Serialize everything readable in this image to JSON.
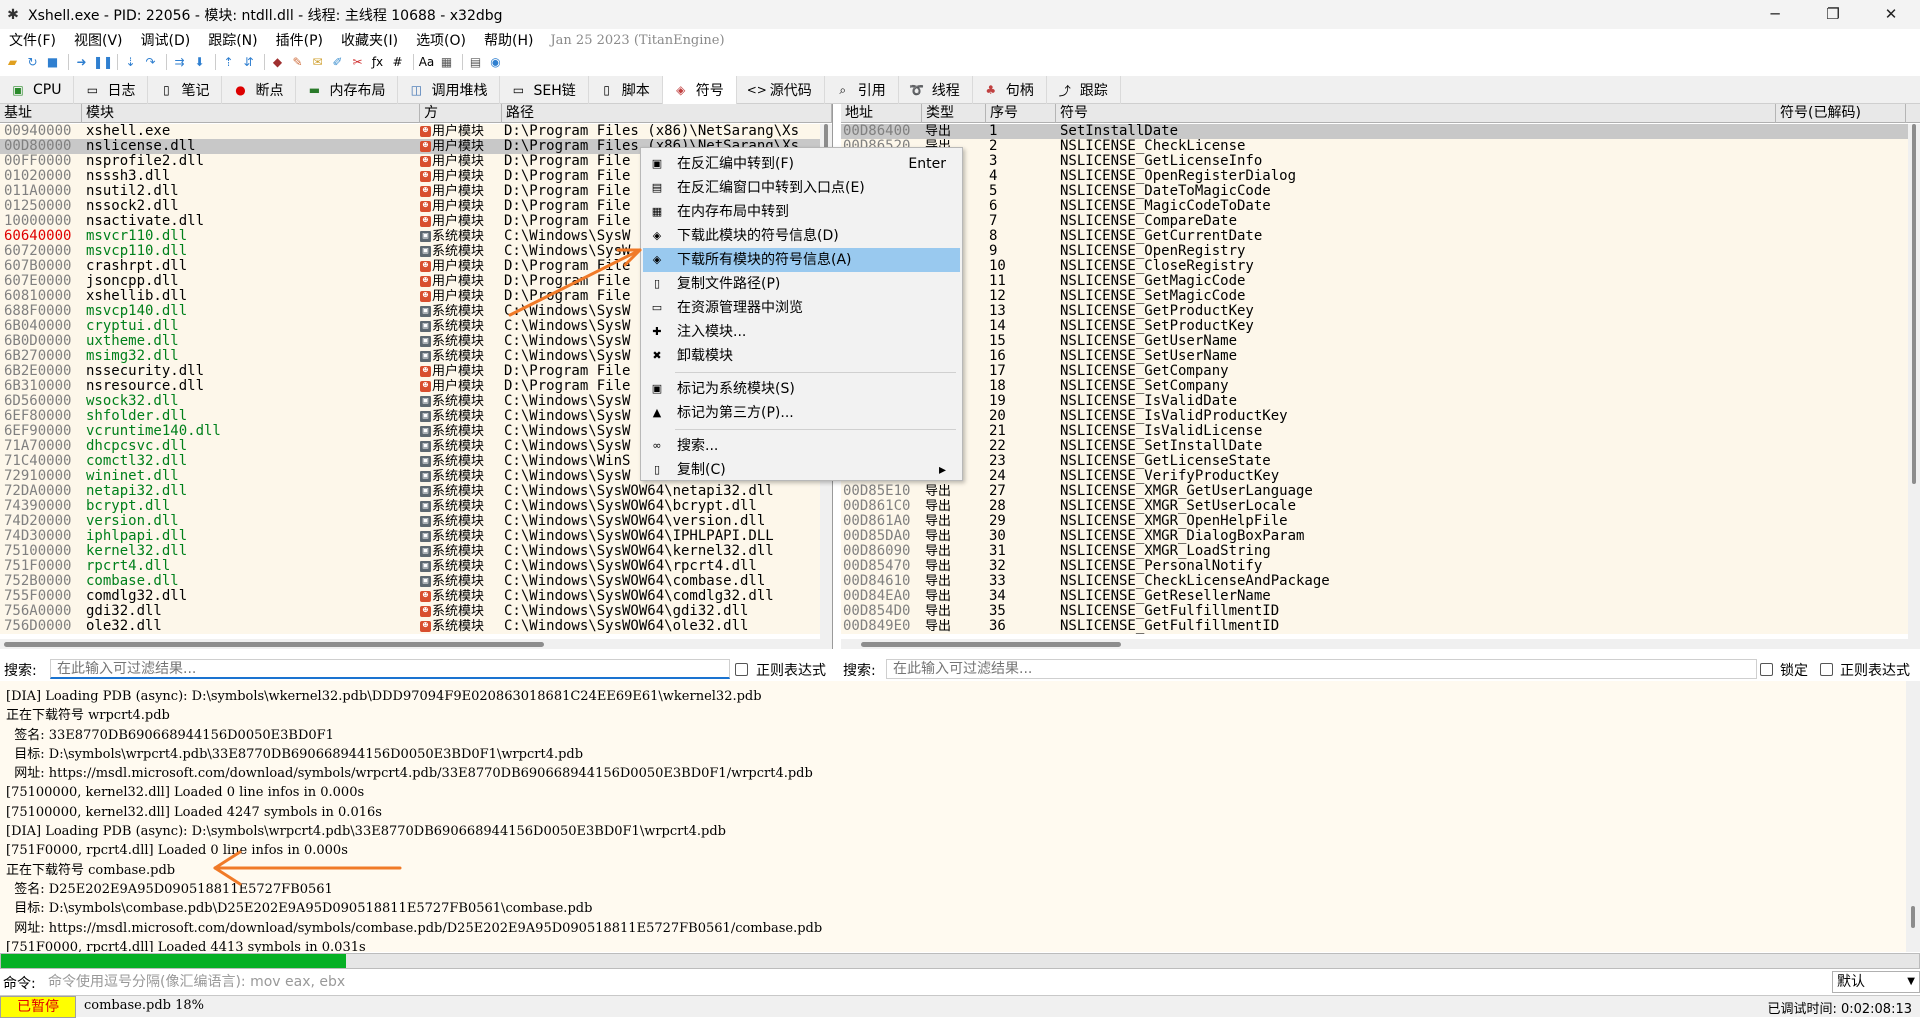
{
  "title": "Xshell.exe - PID: 22056 - 模块: ntdll.dll - 线程: 主线程 10688 - x32dbg",
  "menu": [
    "文件(F)",
    "视图(V)",
    "调试(D)",
    "跟踪(N)",
    "插件(P)",
    "收藏夹(I)",
    "选项(O)",
    "帮助(H)"
  ],
  "build_date": "Jan 25 2023 (TitanEngine)",
  "tabs": [
    "CPU",
    "日志",
    "笔记",
    "断点",
    "内存布局",
    "调用堆栈",
    "SEH链",
    "脚本",
    "符号",
    "源代码",
    "引用",
    "线程",
    "句柄",
    "跟踪"
  ],
  "active_tab": "符号",
  "modules": {
    "headers": [
      "基址",
      "模块",
      "方",
      "路径"
    ],
    "rows": [
      {
        "base": "00940000",
        "name": "xshell.exe",
        "type": "用户模块",
        "path": "D:\\Program Files (x86)\\NetSarang\\Xs",
        "kind": "user"
      },
      {
        "base": "00D80000",
        "name": "nslicense.dll",
        "type": "用户模块",
        "path": "D:\\Program Files (x86)\\NetSarang\\Xs",
        "kind": "user",
        "selected": true
      },
      {
        "base": "00FF0000",
        "name": "nsprofile2.dll",
        "type": "用户模块",
        "path": "D:\\Program File",
        "kind": "user"
      },
      {
        "base": "01020000",
        "name": "nsssh3.dll",
        "type": "用户模块",
        "path": "D:\\Program File",
        "kind": "user"
      },
      {
        "base": "011A0000",
        "name": "nsutil2.dll",
        "type": "用户模块",
        "path": "D:\\Program File",
        "kind": "user"
      },
      {
        "base": "01250000",
        "name": "nssock2.dll",
        "type": "用户模块",
        "path": "D:\\Program File",
        "kind": "user"
      },
      {
        "base": "10000000",
        "name": "nsactivate.dll",
        "type": "用户模块",
        "path": "D:\\Program File",
        "kind": "user"
      },
      {
        "base": "60640000",
        "name": "msvcr110.dll",
        "type": "系统模块",
        "path": "C:\\Windows\\SysW",
        "kind": "sys",
        "basered": true
      },
      {
        "base": "60720000",
        "name": "msvcp110.dll",
        "type": "系统模块",
        "path": "C:\\Windows\\SysW",
        "kind": "sys"
      },
      {
        "base": "607B0000",
        "name": "crashrpt.dll",
        "type": "用户模块",
        "path": "D:\\Program File",
        "kind": "user"
      },
      {
        "base": "607E0000",
        "name": "jsoncpp.dll",
        "type": "用户模块",
        "path": "D:\\Program File",
        "kind": "user"
      },
      {
        "base": "60810000",
        "name": "xshellib.dll",
        "type": "用户模块",
        "path": "D:\\Program File",
        "kind": "user"
      },
      {
        "base": "688F0000",
        "name": "msvcp140.dll",
        "type": "系统模块",
        "path": "C:\\Windows\\SysW",
        "kind": "sys"
      },
      {
        "base": "6B040000",
        "name": "cryptui.dll",
        "type": "系统模块",
        "path": "C:\\Windows\\SysW",
        "kind": "sys"
      },
      {
        "base": "6B0D0000",
        "name": "uxtheme.dll",
        "type": "系统模块",
        "path": "C:\\Windows\\SysW",
        "kind": "sys"
      },
      {
        "base": "6B270000",
        "name": "msimg32.dll",
        "type": "系统模块",
        "path": "C:\\Windows\\SysW",
        "kind": "sys"
      },
      {
        "base": "6B2E0000",
        "name": "nssecurity.dll",
        "type": "用户模块",
        "path": "D:\\Program File",
        "kind": "user"
      },
      {
        "base": "6B310000",
        "name": "nsresource.dll",
        "type": "用户模块",
        "path": "D:\\Program File",
        "kind": "user"
      },
      {
        "base": "6D560000",
        "name": "wsock32.dll",
        "type": "系统模块",
        "path": "C:\\Windows\\SysW",
        "kind": "sys"
      },
      {
        "base": "6EF80000",
        "name": "shfolder.dll",
        "type": "系统模块",
        "path": "C:\\Windows\\SysW",
        "kind": "sys"
      },
      {
        "base": "6EF90000",
        "name": "vcruntime140.dll",
        "type": "系统模块",
        "path": "C:\\Windows\\SysW",
        "kind": "sys"
      },
      {
        "base": "71A70000",
        "name": "dhcpcsvc.dll",
        "type": "系统模块",
        "path": "C:\\Windows\\SysW",
        "kind": "sys"
      },
      {
        "base": "71C40000",
        "name": "comctl32.dll",
        "type": "系统模块",
        "path": "C:\\Windows\\WinS",
        "kind": "sys"
      },
      {
        "base": "72910000",
        "name": "wininet.dll",
        "type": "系统模块",
        "path": "C:\\Windows\\SysW",
        "kind": "sys"
      },
      {
        "base": "72DA0000",
        "name": "netapi32.dll",
        "type": "系统模块",
        "path": "C:\\Windows\\SysWOW64\\netapi32.dll",
        "kind": "sys"
      },
      {
        "base": "74390000",
        "name": "bcrypt.dll",
        "type": "系统模块",
        "path": "C:\\Windows\\SysWOW64\\bcrypt.dll",
        "kind": "sys"
      },
      {
        "base": "74D20000",
        "name": "version.dll",
        "type": "系统模块",
        "path": "C:\\Windows\\SysWOW64\\version.dll",
        "kind": "sys"
      },
      {
        "base": "74D30000",
        "name": "iphlpapi.dll",
        "type": "系统模块",
        "path": "C:\\Windows\\SysWOW64\\IPHLPAPI.DLL",
        "kind": "sys"
      },
      {
        "base": "75100000",
        "name": "kernel32.dll",
        "type": "系统模块",
        "path": "C:\\Windows\\SysWOW64\\kernel32.dll",
        "kind": "sys"
      },
      {
        "base": "751F0000",
        "name": "rpcrt4.dll",
        "type": "系统模块",
        "path": "C:\\Windows\\SysWOW64\\rpcrt4.dll",
        "kind": "sys"
      },
      {
        "base": "752B0000",
        "name": "combase.dll",
        "type": "系统模块",
        "path": "C:\\Windows\\SysWOW64\\combase.dll",
        "kind": "sys"
      },
      {
        "base": "755F0000",
        "name": "comdlg32.dll",
        "type": "系统模块",
        "path": "C:\\Windows\\SysWOW64\\comdlg32.dll",
        "kind": "user"
      },
      {
        "base": "756A0000",
        "name": "gdi32.dll",
        "type": "系统模块",
        "path": "C:\\Windows\\SysWOW64\\gdi32.dll",
        "kind": "user"
      },
      {
        "base": "756D0000",
        "name": "ole32.dll",
        "type": "系统模块",
        "path": "C:\\Windows\\SysWOW64\\ole32.dll",
        "kind": "user"
      }
    ]
  },
  "symbols": {
    "headers": [
      "地址",
      "类型",
      "序号",
      "符号",
      "符号(已解码)"
    ],
    "rows": [
      {
        "addr": "00D86400",
        "type": "导出",
        "ord": "1",
        "sym": "SetInstallDate"
      },
      {
        "addr": "00D86520",
        "type": "导出",
        "ord": "2",
        "sym": "NSLICENSE_CheckLicense"
      },
      {
        "addr": "",
        "type": "",
        "ord": "3",
        "sym": "NSLICENSE_GetLicenseInfo"
      },
      {
        "addr": "",
        "type": "",
        "ord": "4",
        "sym": "NSLICENSE_OpenRegisterDialog"
      },
      {
        "addr": "",
        "type": "",
        "ord": "5",
        "sym": "NSLICENSE_DateToMagicCode"
      },
      {
        "addr": "",
        "type": "",
        "ord": "6",
        "sym": "NSLICENSE_MagicCodeToDate"
      },
      {
        "addr": "",
        "type": "",
        "ord": "7",
        "sym": "NSLICENSE_CompareDate"
      },
      {
        "addr": "",
        "type": "",
        "ord": "8",
        "sym": "NSLICENSE_GetCurrentDate"
      },
      {
        "addr": "",
        "type": "",
        "ord": "9",
        "sym": "NSLICENSE_OpenRegistry"
      },
      {
        "addr": "",
        "type": "",
        "ord": "10",
        "sym": "NSLICENSE_CloseRegistry"
      },
      {
        "addr": "",
        "type": "",
        "ord": "11",
        "sym": "NSLICENSE_GetMagicCode"
      },
      {
        "addr": "",
        "type": "",
        "ord": "12",
        "sym": "NSLICENSE_SetMagicCode"
      },
      {
        "addr": "",
        "type": "",
        "ord": "13",
        "sym": "NSLICENSE_GetProductKey"
      },
      {
        "addr": "",
        "type": "",
        "ord": "14",
        "sym": "NSLICENSE_SetProductKey"
      },
      {
        "addr": "",
        "type": "",
        "ord": "15",
        "sym": "NSLICENSE_GetUserName"
      },
      {
        "addr": "",
        "type": "",
        "ord": "16",
        "sym": "NSLICENSE_SetUserName"
      },
      {
        "addr": "",
        "type": "",
        "ord": "17",
        "sym": "NSLICENSE_GetCompany"
      },
      {
        "addr": "",
        "type": "",
        "ord": "18",
        "sym": "NSLICENSE_SetCompany"
      },
      {
        "addr": "",
        "type": "",
        "ord": "19",
        "sym": "NSLICENSE_IsValidDate"
      },
      {
        "addr": "",
        "type": "",
        "ord": "20",
        "sym": "NSLICENSE_IsValidProductKey"
      },
      {
        "addr": "",
        "type": "",
        "ord": "21",
        "sym": "NSLICENSE_IsValidLicense"
      },
      {
        "addr": "",
        "type": "",
        "ord": "22",
        "sym": "NSLICENSE_SetInstallDate"
      },
      {
        "addr": "",
        "type": "",
        "ord": "23",
        "sym": "NSLICENSE_GetLicenseState"
      },
      {
        "addr": "",
        "type": "",
        "ord": "24",
        "sym": "NSLICENSE_VerifyProductKey"
      },
      {
        "addr": "00D85E10",
        "type": "导出",
        "ord": "27",
        "sym": "NSLICENSE_XMGR_GetUserLanguage"
      },
      {
        "addr": "00D861C0",
        "type": "导出",
        "ord": "28",
        "sym": "NSLICENSE_XMGR_SetUserLocale"
      },
      {
        "addr": "00D861A0",
        "type": "导出",
        "ord": "29",
        "sym": "NSLICENSE_XMGR_OpenHelpFile"
      },
      {
        "addr": "00D85DA0",
        "type": "导出",
        "ord": "30",
        "sym": "NSLICENSE_XMGR_DialogBoxParam"
      },
      {
        "addr": "00D86090",
        "type": "导出",
        "ord": "31",
        "sym": "NSLICENSE_XMGR_LoadString"
      },
      {
        "addr": "00D85470",
        "type": "导出",
        "ord": "32",
        "sym": "NSLICENSE_PersonalNotify"
      },
      {
        "addr": "00D84610",
        "type": "导出",
        "ord": "33",
        "sym": "NSLICENSE_CheckLicenseAndPackage"
      },
      {
        "addr": "00D84EA0",
        "type": "导出",
        "ord": "34",
        "sym": "NSLICENSE_GetResellerName"
      },
      {
        "addr": "00D854D0",
        "type": "导出",
        "ord": "35",
        "sym": "NSLICENSE_GetFulfillmentID"
      },
      {
        "addr": "00D849E0",
        "type": "导出",
        "ord": "36",
        "sym": "NSLICENSE_GetFulfillmentID"
      }
    ]
  },
  "context_menu": [
    {
      "label": "在反汇编中转到(F)",
      "shortcut": "Enter",
      "icon": "disasm-icon"
    },
    {
      "label": "在反汇编窗口中转到入口点(E)",
      "icon": "entry-icon"
    },
    {
      "label": "在内存布局中转到",
      "icon": "memory-icon"
    },
    {
      "label": "下载此模块的符号信息(D)",
      "icon": "download-icon"
    },
    {
      "label": "下载所有模块的符号信息(A)",
      "icon": "download-all-icon",
      "highlighted": true
    },
    {
      "label": "复制文件路径(P)",
      "icon": "copy-path-icon"
    },
    {
      "label": "在资源管理器中浏览",
      "icon": "explorer-icon"
    },
    {
      "label": "注入模块...",
      "icon": "inject-icon"
    },
    {
      "label": "卸载模块",
      "icon": "unload-icon",
      "sep_after": true
    },
    {
      "label": "标记为系统模块(S)",
      "icon": "system-icon"
    },
    {
      "label": "标记为第三方(P)...",
      "icon": "third-party-icon",
      "sep_after": true
    },
    {
      "label": "搜索...",
      "icon": "binoculars-icon"
    },
    {
      "label": "复制(C)",
      "icon": "copy-icon",
      "submenu": true
    }
  ],
  "search_left": {
    "label": "搜索:",
    "placeholder": "在此输入可过滤结果...",
    "regex_label": "正则表达式"
  },
  "search_right": {
    "label": "搜索:",
    "placeholder": "在此输入可过滤结果...",
    "lock_label": "锁定",
    "regex_label": "正则表达式"
  },
  "log_lines": [
    "[DIA] Loading PDB (async): D:\\symbols\\wkernel32.pdb\\DDD97094F9E020863018681C24EE69E61\\wkernel32.pdb",
    "正在下载符号 wrpcrt4.pdb",
    "  签名: 33E8770DB690668944156D0050E3BD0F1",
    "  目标: D:\\symbols\\wrpcrt4.pdb\\33E8770DB690668944156D0050E3BD0F1\\wrpcrt4.pdb",
    "  网址: https://msdl.microsoft.com/download/symbols/wrpcrt4.pdb/33E8770DB690668944156D0050E3BD0F1/wrpcrt4.pdb",
    "[75100000, kernel32.dll] Loaded 0 line infos in 0.000s",
    "[75100000, kernel32.dll] Loaded 4247 symbols in 0.016s",
    "[DIA] Loading PDB (async): D:\\symbols\\wrpcrt4.pdb\\33E8770DB690668944156D0050E3BD0F1\\wrpcrt4.pdb",
    "[751F0000, rpcrt4.dll] Loaded 0 line infos in 0.000s",
    "正在下载符号 combase.pdb",
    "  签名: D25E202E9A95D090518811E5727FB0561",
    "  目标: D:\\symbols\\combase.pdb\\D25E202E9A95D090518811E5727FB0561\\combase.pdb",
    "  网址: https://msdl.microsoft.com/download/symbols/combase.pdb/D25E202E9A95D090518811E5727FB0561/combase.pdb",
    "[751F0000, rpcrt4.dll] Loaded 4413 symbols in 0.031s"
  ],
  "progress": 0.18,
  "cmd": {
    "label": "命令:",
    "placeholder": "命令使用逗号分隔(像汇编语言): mov eax, ebx",
    "mode": "默认"
  },
  "status": {
    "state": "已暂停",
    "message": "combase.pdb  18%",
    "debug_time": "已调试时间: 0:02:08:13"
  },
  "colors": {
    "accent_highlight": "#99c9ef",
    "progress": "#06b025",
    "sys_module": "#00801c",
    "arrow": "#f07a28"
  }
}
